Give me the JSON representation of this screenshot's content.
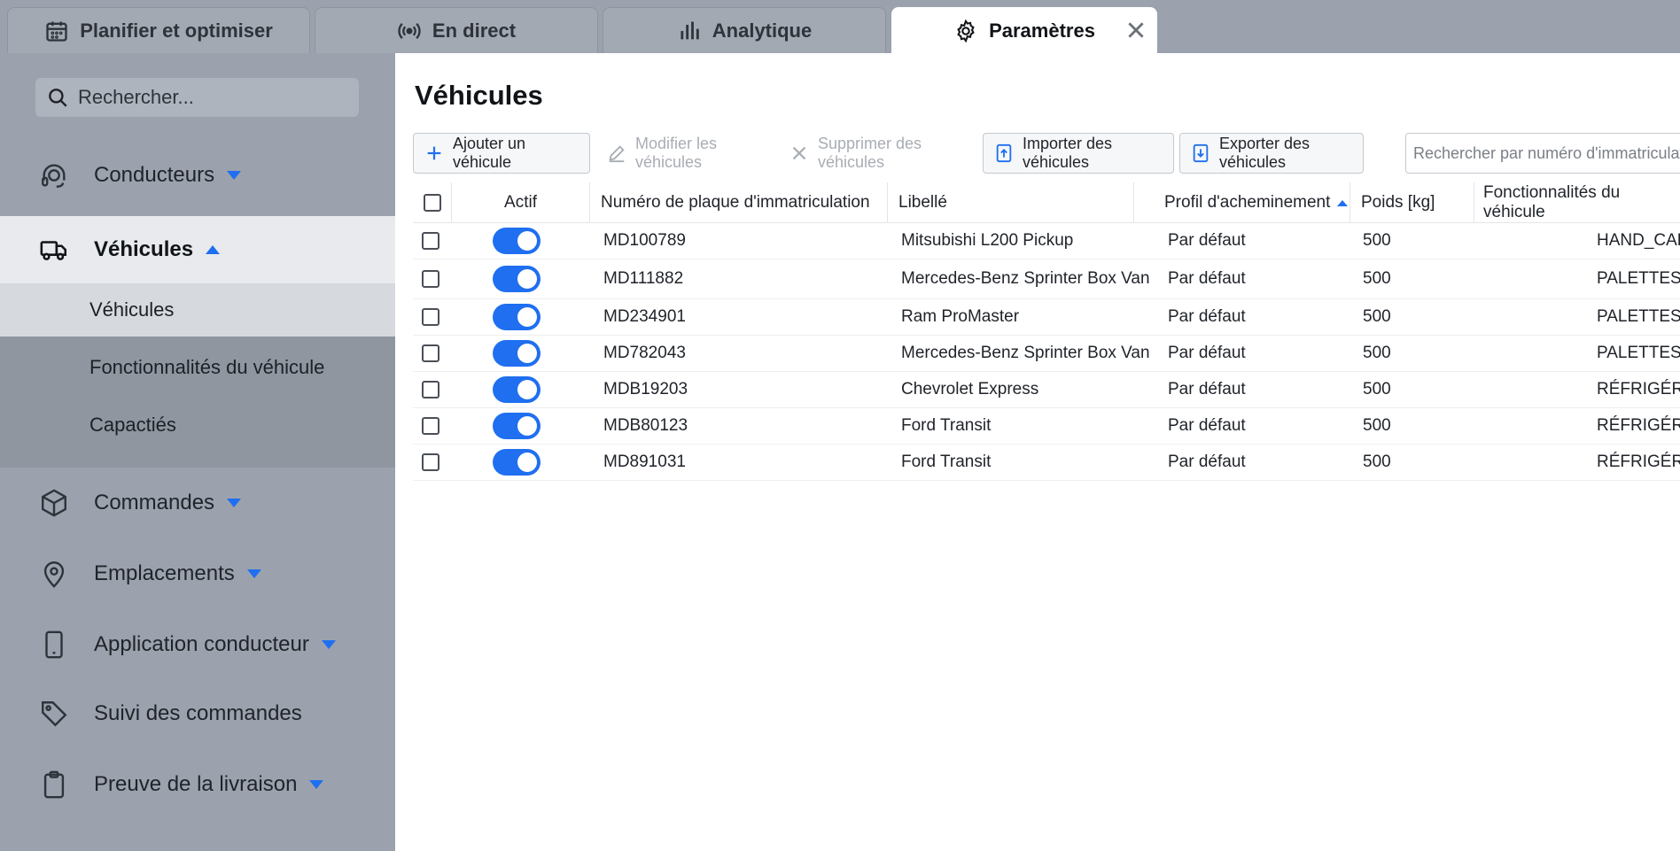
{
  "tabs": [
    {
      "label": "Planifier et optimiser",
      "icon": "calendar-icon"
    },
    {
      "label": "En direct",
      "icon": "broadcast-icon"
    },
    {
      "label": "Analytique",
      "icon": "bar-chart-icon"
    },
    {
      "label": "Paramètres",
      "icon": "gear-icon",
      "active": true
    }
  ],
  "sidebar": {
    "search_placeholder": "Rechercher...",
    "items": [
      {
        "label": "Conducteurs",
        "icon": "headset-icon"
      },
      {
        "label": "Véhicules",
        "icon": "truck-icon"
      },
      {
        "label": "Commandes",
        "icon": "box-icon"
      },
      {
        "label": "Emplacements",
        "icon": "location-pin-icon"
      },
      {
        "label": "Application conducteur",
        "icon": "phone-icon"
      },
      {
        "label": "Suivi des commandes",
        "icon": "tag-icon"
      },
      {
        "label": "Preuve de la livraison",
        "icon": "clipboard-icon"
      }
    ],
    "vehicle_subitems": [
      "Véhicules",
      "Fonctionnalités du véhicule",
      "Capactiés"
    ]
  },
  "main": {
    "title": "Véhicules",
    "toolbar": {
      "add": "Ajouter un véhicule",
      "edit": "Modifier les véhicules",
      "delete": "Supprimer des véhicules",
      "import": "Importer des véhicules",
      "export": "Exporter des véhicules",
      "plate_search_placeholder": "Rechercher par numéro d'immatriculation"
    },
    "columns": {
      "active": "Actif",
      "plate": "Numéro de plaque d'immatriculation",
      "label": "Libellé",
      "profile": "Profil d'acheminement",
      "weight": "Poids [kg]",
      "features": "Fonctionnalités du véhicule"
    },
    "rows": [
      {
        "plate": "MD100789",
        "label": "Mitsubishi L200 Pickup",
        "profile": "Par défaut",
        "weight": "500",
        "features": "HAND_CAR"
      },
      {
        "plate": "MD111882",
        "label": "Mercedes-Benz Sprinter Box Van",
        "profile": "Par défaut",
        "weight": "500",
        "features": "PALETTES"
      },
      {
        "plate": "MD234901",
        "label": "Ram ProMaster",
        "profile": "Par défaut",
        "weight": "500",
        "features": "PALETTES"
      },
      {
        "plate": "MD782043",
        "label": "Mercedes-Benz Sprinter Box Van",
        "profile": "Par défaut",
        "weight": "500",
        "features": "PALETTES"
      },
      {
        "plate": "MDB19203",
        "label": "Chevrolet Express",
        "profile": "Par défaut",
        "weight": "500",
        "features": "RÉFRIGÉRÉ, L"
      },
      {
        "plate": "MDB80123",
        "label": "Ford Transit",
        "profile": "Par défaut",
        "weight": "500",
        "features": "RÉFRIGÉRÉ, L"
      },
      {
        "plate": "MD891031",
        "label": "Ford Transit",
        "profile": "Par défaut",
        "weight": "500",
        "features": "RÉFRIGÉRÉ, L"
      }
    ]
  },
  "colors": {
    "accent": "#1f6ff0",
    "sidebar_bg": "#9ba2ad",
    "selected_bg": "#e8eaed"
  }
}
